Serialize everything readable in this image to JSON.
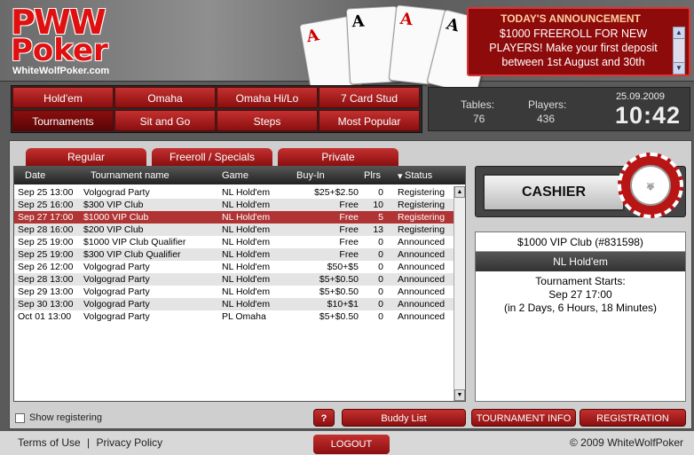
{
  "header": {
    "logo_line1": "PWW",
    "logo_line2": "Poker",
    "logo_site": "WhiteWolfPoker.com",
    "cards": [
      "A",
      "A",
      "A",
      "A"
    ],
    "announcement_title": "TODAY'S ANNOUNCEMENT",
    "announcement_body": "$1000 FREEROLL FOR NEW PLAYERS! Make your first deposit between 1st August and 30th"
  },
  "nav": {
    "row1": [
      "Hold'em",
      "Omaha",
      "Omaha Hi/Lo",
      "7 Card Stud"
    ],
    "row2": [
      "Tournaments",
      "Sit and Go",
      "Steps",
      "Most Popular"
    ]
  },
  "stats": {
    "tables_label": "Tables:",
    "tables_value": "76",
    "players_label": "Players:",
    "players_value": "436",
    "date": "25.09.2009",
    "time": "10:42"
  },
  "tabs": [
    "Regular",
    "Freeroll / Specials",
    "Private"
  ],
  "table": {
    "headers": [
      "Date",
      "Tournament name",
      "Game",
      "Buy-In",
      "Plrs",
      "Status"
    ],
    "rows": [
      [
        "Sep 25 13:00",
        "Volgograd Party",
        "NL Hold'em",
        "$25+$2.50",
        "0",
        "Registering"
      ],
      [
        "Sep 25 16:00",
        "$300 VIP Club",
        "NL Hold'em",
        "Free",
        "10",
        "Registering"
      ],
      [
        "Sep 27 17:00",
        "$1000 VIP Club",
        "NL Hold'em",
        "Free",
        "5",
        "Registering"
      ],
      [
        "Sep 28 16:00",
        "$200 VIP Club",
        "NL Hold'em",
        "Free",
        "13",
        "Registering"
      ],
      [
        "Sep 25 19:00",
        "$1000 VIP Club Qualifier",
        "NL Hold'em",
        "Free",
        "0",
        "Announced"
      ],
      [
        "Sep 25 19:00",
        "$300 VIP Club Qualifier",
        "NL Hold'em",
        "Free",
        "0",
        "Announced"
      ],
      [
        "Sep 26 12:00",
        "Volgograd Party",
        "NL Hold'em",
        "$50+$5",
        "0",
        "Announced"
      ],
      [
        "Sep 28 13:00",
        "Volgograd Party",
        "NL Hold'em",
        "$5+$0.50",
        "0",
        "Announced"
      ],
      [
        "Sep 29 13:00",
        "Volgograd Party",
        "NL Hold'em",
        "$5+$0.50",
        "0",
        "Announced"
      ],
      [
        "Sep 30 13:00",
        "Volgograd Party",
        "NL Hold'em",
        "$10+$1",
        "0",
        "Announced"
      ],
      [
        "Oct 01 13:00",
        "Volgograd Party",
        "PL Omaha",
        "$5+$0.50",
        "0",
        "Announced"
      ]
    ]
  },
  "cashier": {
    "label": "CASHIER"
  },
  "detail": {
    "name": "$1000 VIP Club (#831598)",
    "game": "NL Hold'em",
    "starts_label": "Tournament Starts:",
    "starts_date": "Sep 27 17:00",
    "starts_remaining": "(in 2 Days, 6 Hours, 18 Minutes)"
  },
  "bottom": {
    "show_registering": "Show registering",
    "help": "?",
    "buddy": "Buddy List",
    "info": "TOURNAMENT INFO",
    "registration": "REGISTRATION"
  },
  "footer": {
    "terms": "Terms of Use",
    "sep": "|",
    "privacy": "Privacy Policy",
    "logout": "LOGOUT",
    "copyright": "© 2009 WhiteWolfPoker"
  },
  "colors": {
    "accent": "#b03434",
    "dark": "#2a2a2a",
    "announce_bg": "#8e0b0b"
  }
}
